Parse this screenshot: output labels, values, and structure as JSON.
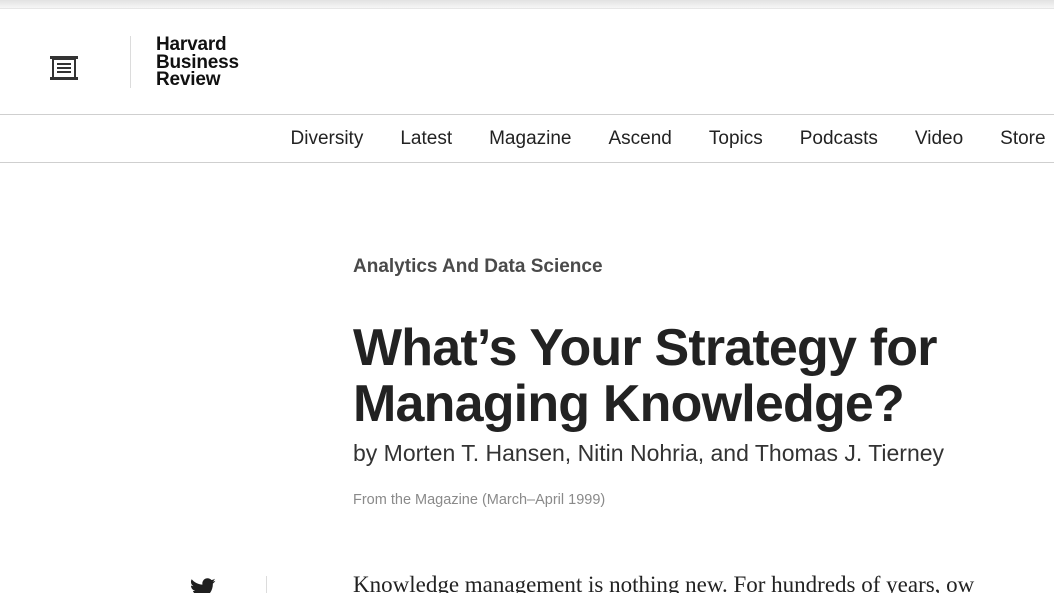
{
  "header": {
    "menu_icon": "menu-icon",
    "logo": {
      "line1": "Harvard",
      "line2": "Business",
      "line3": "Review"
    }
  },
  "nav": {
    "items": [
      {
        "label": "Diversity"
      },
      {
        "label": "Latest"
      },
      {
        "label": "Magazine"
      },
      {
        "label": "Ascend"
      },
      {
        "label": "Topics"
      },
      {
        "label": "Podcasts"
      },
      {
        "label": "Video"
      },
      {
        "label": "Store"
      }
    ]
  },
  "article": {
    "topic": "Analytics And Data Science",
    "title": "What’s Your Strategy for Managing Knowledge?",
    "byline": "by Morten T. Hansen, Nitin Nohria, and Thomas J. Tierney",
    "source": "From the Magazine (March–April 1999)",
    "body_first_line": "Knowledge management is nothing new. For hundreds of years, ow"
  },
  "share": {
    "twitter_icon": "twitter-icon"
  },
  "colors": {
    "text": "#222222",
    "muted": "#8a8a8a",
    "rule": "#cfcfcf"
  }
}
